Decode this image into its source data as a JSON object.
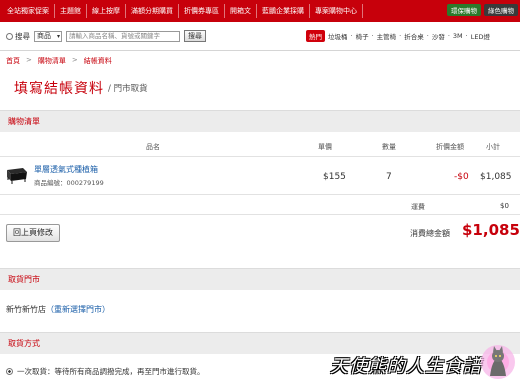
{
  "topnav": {
    "items": [
      "全站獨家促案",
      "主題館",
      "線上按摩",
      "滿額分期購買",
      "折價券專區",
      "開箱文",
      "藍鵬企業採購",
      "專案購物中心"
    ],
    "promo": [
      "環保購物",
      "綠色購物"
    ]
  },
  "search": {
    "label": "搜尋",
    "category": "商品",
    "placeholder": "請輸入商品名稱、貨號或關鍵字",
    "button": "搜尋",
    "hot_badge": "熱門",
    "hot_words": [
      "垃圾桶",
      "椅子",
      "主管椅",
      "折合桌",
      "沙發",
      "3M",
      "LED燈"
    ]
  },
  "breadcrumb": [
    "首頁",
    ">",
    "購物清單",
    ">",
    "結帳資料"
  ],
  "page": {
    "title": "填寫結帳資料",
    "subtitle": "/ 門市取貨"
  },
  "cart": {
    "section_title": "購物清單",
    "columns": {
      "name": "品名",
      "price": "單價",
      "qty": "數量",
      "discount": "折價金額",
      "subtotal": "小計"
    },
    "item": {
      "name": "單層透氣式種植箱",
      "code": "商品編號：000279199",
      "price": "$155",
      "qty": "7",
      "discount": "-$0",
      "subtotal": "$1,085"
    },
    "shipping_label": "運費",
    "shipping_value": "$0",
    "back_button": "回上頁修改",
    "total_label": "消費總金額",
    "total_value": "$1,085"
  },
  "store": {
    "section_title": "取貨門市",
    "store_name": "新竹新竹店",
    "change_link": "（重新選擇門市）"
  },
  "payment": {
    "section_title": "取貨方式",
    "option": "一次取貨：等待所有商品調撥完成，再至門市進行取貨。"
  },
  "watermark": "天使熊的人生食譜",
  "colors": {
    "brand": "#c7000b",
    "link": "#1a5ea8",
    "section_bg": "#ececec"
  }
}
